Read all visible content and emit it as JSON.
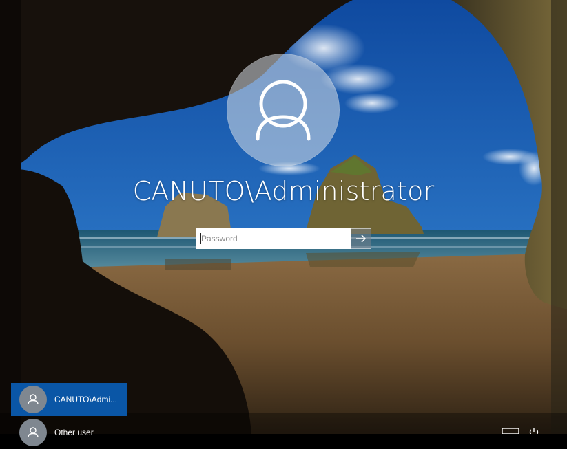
{
  "login": {
    "username": "CANUTO\\Administrator",
    "password_placeholder": "Password",
    "submit_icon": "arrow-right-icon",
    "avatar_icon": "user-icon"
  },
  "user_list": [
    {
      "label": "CANUTO\\Admi...",
      "selected": true,
      "icon": "user-icon"
    },
    {
      "label": "Other user",
      "selected": false,
      "icon": "user-icon"
    }
  ],
  "system_tray": {
    "icons": [
      "network-icon",
      "power-icon"
    ]
  },
  "colors": {
    "selected_tile": "#0a56a6",
    "text": "#ffffff"
  }
}
